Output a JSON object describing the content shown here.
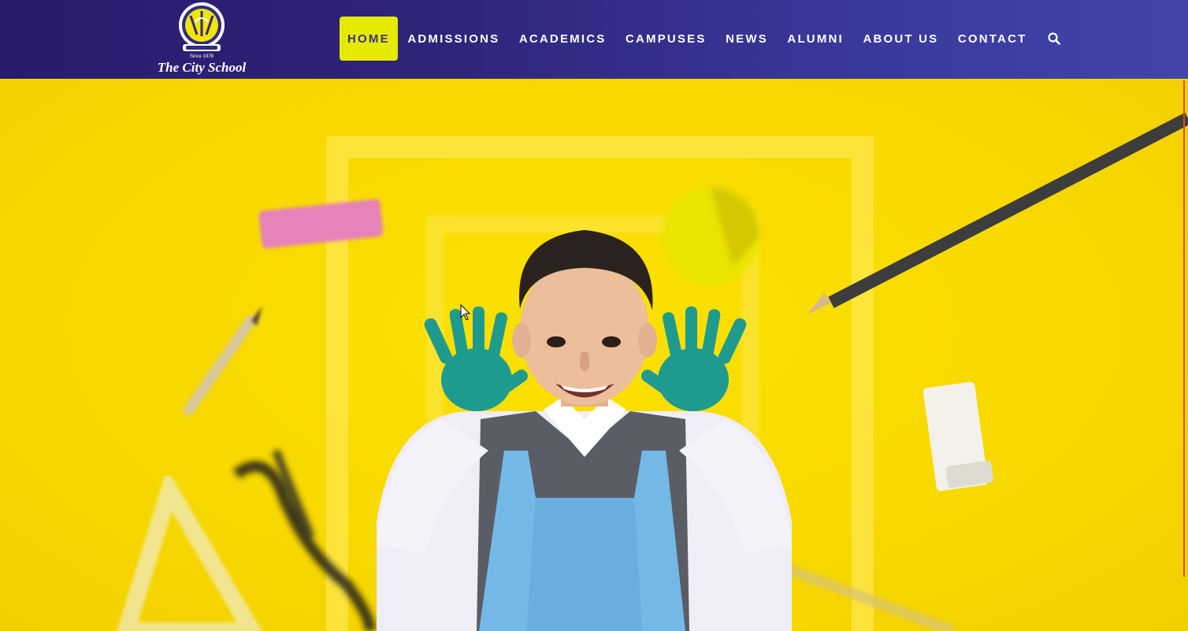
{
  "brand": {
    "name": "The City School",
    "since": "Since 1978",
    "colors": {
      "header_start": "#2a1a6e",
      "header_end": "#4244ab",
      "accent": "#e6ea00",
      "hero": "#f8d900"
    }
  },
  "nav": {
    "items": [
      {
        "label": "HOME",
        "active": true
      },
      {
        "label": "ADMISSIONS",
        "active": false
      },
      {
        "label": "ACADEMICS",
        "active": false
      },
      {
        "label": "CAMPUSES",
        "active": false
      },
      {
        "label": "NEWS",
        "active": false
      },
      {
        "label": "ALUMNI",
        "active": false
      },
      {
        "label": "ABOUT US",
        "active": false
      },
      {
        "label": "CONTACT",
        "active": false
      }
    ],
    "search_icon": "search-icon"
  },
  "hero": {
    "image": "child-with-painted-hands"
  }
}
